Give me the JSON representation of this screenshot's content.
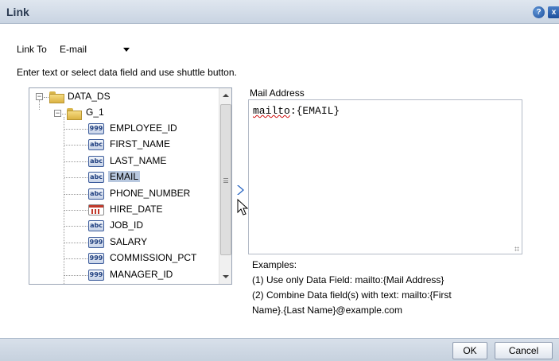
{
  "dialog": {
    "title": "Link",
    "help_icon": "help-icon",
    "close_icon": "close-icon",
    "help_glyph": "?",
    "close_glyph": "x"
  },
  "link_to": {
    "label": "Link To",
    "selected": "E-mail"
  },
  "instructions": "Enter text or select data field and use shuttle button.",
  "tree": {
    "root": {
      "label": "DATA_DS",
      "toggle": "−",
      "icon": "folder-icon"
    },
    "group": {
      "label": "G_1",
      "toggle": "−",
      "icon": "folder-icon"
    },
    "fields": [
      {
        "label": "EMPLOYEE_ID",
        "type_badge": "999",
        "icon": "number-field-icon"
      },
      {
        "label": "FIRST_NAME",
        "type_badge": "abc",
        "icon": "text-field-icon"
      },
      {
        "label": "LAST_NAME",
        "type_badge": "abc",
        "icon": "text-field-icon"
      },
      {
        "label": "EMAIL",
        "type_badge": "abc",
        "icon": "text-field-icon",
        "selected": true
      },
      {
        "label": "PHONE_NUMBER",
        "type_badge": "abc",
        "icon": "text-field-icon"
      },
      {
        "label": "HIRE_DATE",
        "type_badge": "",
        "icon": "date-field-icon"
      },
      {
        "label": "JOB_ID",
        "type_badge": "abc",
        "icon": "text-field-icon"
      },
      {
        "label": "SALARY",
        "type_badge": "999",
        "icon": "number-field-icon"
      },
      {
        "label": "COMMISSION_PCT",
        "type_badge": "999",
        "icon": "number-field-icon"
      },
      {
        "label": "MANAGER_ID",
        "type_badge": "999",
        "icon": "number-field-icon"
      }
    ]
  },
  "shuttle": {
    "icon": "chevron-right-icon",
    "cursor_icon": "mouse-pointer-icon"
  },
  "mail_address": {
    "label": "Mail Address",
    "value_prefix": "mailto",
    "value_rest": ":{EMAIL}"
  },
  "examples": {
    "heading": "Examples:",
    "line1": "(1) Use only Data Field: mailto:{Mail Address}",
    "line2": "(2) Combine Data field(s) with text: mailto:{First",
    "line3": "Name}.{Last Name}@example.com"
  },
  "buttons": {
    "ok": "OK",
    "cancel": "Cancel"
  },
  "colors": {
    "title_bar": "#c9d4e2",
    "selection": "#b8c8df",
    "spellcheck": "#d01010",
    "help_icon": "#1d4f9c"
  }
}
